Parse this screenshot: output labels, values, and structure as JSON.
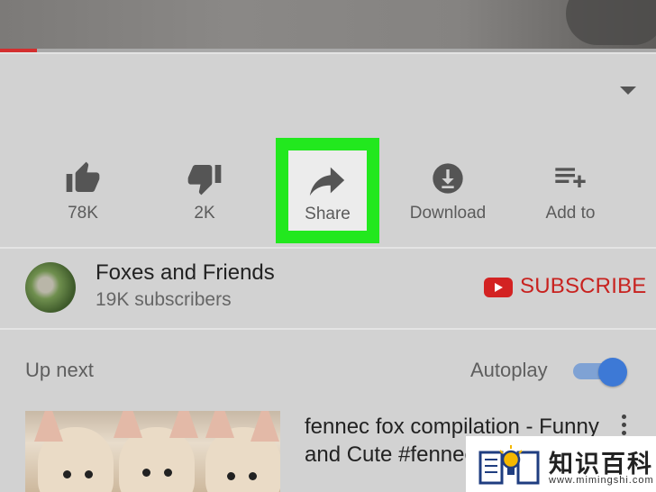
{
  "player": {
    "progress_fraction": 0.057
  },
  "actions": [
    {
      "icon": "thumbs-up-icon",
      "label": "78K"
    },
    {
      "icon": "thumbs-down-icon",
      "label": "2K"
    },
    {
      "icon": "share-icon",
      "label": "Share"
    },
    {
      "icon": "download-icon",
      "label": "Download"
    },
    {
      "icon": "add-to-playlist-icon",
      "label": "Add to"
    }
  ],
  "channel": {
    "name": "Foxes and Friends",
    "subscribers": "19K subscribers",
    "subscribe_label": "SUBSCRIBE"
  },
  "up_next": {
    "label": "Up next",
    "autoplay_label": "Autoplay",
    "autoplay_on": true,
    "video_title": "fennec fox compilation - Funny and Cute #fennecfoxes #"
  },
  "watermark": {
    "text": "知识百科",
    "url": "www.mimingshi.com"
  },
  "colors": {
    "highlight": "#22e81e",
    "subscribe": "#c8221f",
    "toggle": "#3d79d6",
    "progress": "#d32f2f"
  }
}
